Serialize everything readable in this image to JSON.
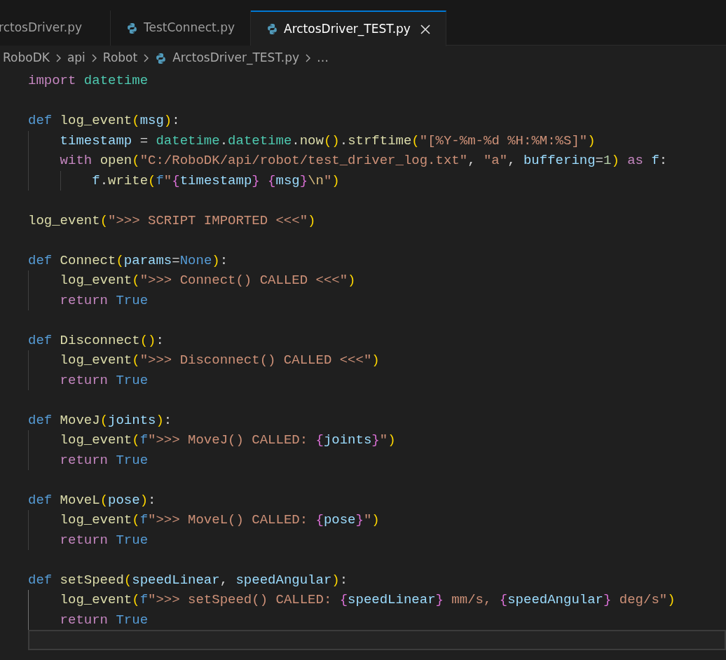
{
  "tabs": [
    {
      "label": "rctosDriver.py",
      "selected": false,
      "python": false,
      "closable": false
    },
    {
      "label": "TestConnect.py",
      "selected": false,
      "python": true,
      "closable": false
    },
    {
      "label": "ArctosDriver_TEST.py",
      "selected": true,
      "python": true,
      "closable": true
    }
  ],
  "breadcrumbs": [
    {
      "label": "RoboDK",
      "python": false
    },
    {
      "label": "api",
      "python": false
    },
    {
      "label": "Robot",
      "python": false
    },
    {
      "label": "ArctosDriver_TEST.py",
      "python": true
    },
    {
      "label": "…",
      "python": false
    }
  ],
  "lines": [
    {
      "current": false,
      "tokens": [
        {
          "kind": "ctrl",
          "text": "import "
        },
        {
          "kind": "module",
          "text": "datetime"
        }
      ]
    },
    {
      "current": false
    },
    {
      "current": false,
      "tokens": [
        {
          "kind": "kw",
          "text": "def "
        },
        {
          "kind": "fn",
          "text": "log_event"
        },
        {
          "kind": "paren",
          "text": "("
        },
        {
          "kind": "var",
          "text": "msg"
        },
        {
          "kind": "paren",
          "text": ")"
        },
        {
          "kind": "plain",
          "text": ":"
        }
      ]
    },
    {
      "current": false,
      "tokens": [
        {
          "kind": "var",
          "text": "    timestamp"
        },
        {
          "kind": "plain",
          "text": " = "
        },
        {
          "kind": "module",
          "text": "datetime"
        },
        {
          "kind": "plain",
          "text": "."
        },
        {
          "kind": "module",
          "text": "datetime"
        },
        {
          "kind": "plain",
          "text": "."
        },
        {
          "kind": "fn",
          "text": "now"
        },
        {
          "kind": "paren",
          "text": "()"
        },
        {
          "kind": "plain",
          "text": "."
        },
        {
          "kind": "fn",
          "text": "strftime"
        },
        {
          "kind": "paren",
          "text": "("
        },
        {
          "kind": "str",
          "text": "\"[%Y-%m-%d %H:%M:%S]\""
        },
        {
          "kind": "paren",
          "text": ")"
        }
      ]
    },
    {
      "current": false,
      "tokens": [
        {
          "kind": "ctrl",
          "text": "    with "
        },
        {
          "kind": "fn",
          "text": "open"
        },
        {
          "kind": "paren",
          "text": "("
        },
        {
          "kind": "str",
          "text": "\"C:/RoboDK/api/robot/test_driver_log.txt\""
        },
        {
          "kind": "plain",
          "text": ", "
        },
        {
          "kind": "str",
          "text": "\"a\""
        },
        {
          "kind": "plain",
          "text": ", "
        },
        {
          "kind": "var",
          "text": "buffering"
        },
        {
          "kind": "plain",
          "text": "="
        },
        {
          "kind": "num",
          "text": "1"
        },
        {
          "kind": "paren",
          "text": ")"
        },
        {
          "kind": "ctrl",
          "text": " as "
        },
        {
          "kind": "var",
          "text": "f"
        },
        {
          "kind": "plain",
          "text": ":"
        }
      ]
    },
    {
      "current": false,
      "tokens": [
        {
          "kind": "var",
          "text": "        f"
        },
        {
          "kind": "plain",
          "text": "."
        },
        {
          "kind": "fn",
          "text": "write"
        },
        {
          "kind": "paren",
          "text": "("
        },
        {
          "kind": "kw",
          "text": "f"
        },
        {
          "kind": "str",
          "text": "\""
        },
        {
          "kind": "brace",
          "text": "{"
        },
        {
          "kind": "var",
          "text": "timestamp"
        },
        {
          "kind": "brace",
          "text": "} {"
        },
        {
          "kind": "var",
          "text": "msg"
        },
        {
          "kind": "brace",
          "text": "}"
        },
        {
          "kind": "esc",
          "text": "\\n"
        },
        {
          "kind": "str",
          "text": "\""
        },
        {
          "kind": "paren",
          "text": ")"
        }
      ]
    },
    {
      "current": false
    },
    {
      "current": false,
      "tokens": [
        {
          "kind": "fn",
          "text": "log_event"
        },
        {
          "kind": "paren",
          "text": "("
        },
        {
          "kind": "str",
          "text": "\">>> SCRIPT IMPORTED <<<\""
        },
        {
          "kind": "paren",
          "text": ")"
        }
      ]
    },
    {
      "current": false
    },
    {
      "current": false,
      "tokens": [
        {
          "kind": "kw",
          "text": "def "
        },
        {
          "kind": "fn",
          "text": "Connect"
        },
        {
          "kind": "paren",
          "text": "("
        },
        {
          "kind": "var",
          "text": "params"
        },
        {
          "kind": "plain",
          "text": "="
        },
        {
          "kind": "kw",
          "text": "None"
        },
        {
          "kind": "paren",
          "text": ")"
        },
        {
          "kind": "plain",
          "text": ":"
        }
      ]
    },
    {
      "current": false,
      "tokens": [
        {
          "kind": "fn",
          "text": "    log_event"
        },
        {
          "kind": "paren",
          "text": "("
        },
        {
          "kind": "str",
          "text": "\">>> Connect() CALLED <<<\""
        },
        {
          "kind": "paren",
          "text": ")"
        }
      ]
    },
    {
      "current": false,
      "tokens": [
        {
          "kind": "ctrl",
          "text": "    return "
        },
        {
          "kind": "kw",
          "text": "True"
        }
      ]
    },
    {
      "current": false
    },
    {
      "current": false,
      "tokens": [
        {
          "kind": "kw",
          "text": "def "
        },
        {
          "kind": "fn",
          "text": "Disconnect"
        },
        {
          "kind": "paren",
          "text": "()"
        },
        {
          "kind": "plain",
          "text": ":"
        }
      ]
    },
    {
      "current": false,
      "tokens": [
        {
          "kind": "fn",
          "text": "    log_event"
        },
        {
          "kind": "paren",
          "text": "("
        },
        {
          "kind": "str",
          "text": "\">>> Disconnect() CALLED <<<\""
        },
        {
          "kind": "paren",
          "text": ")"
        }
      ]
    },
    {
      "current": false,
      "tokens": [
        {
          "kind": "ctrl",
          "text": "    return "
        },
        {
          "kind": "kw",
          "text": "True"
        }
      ]
    },
    {
      "current": false
    },
    {
      "current": false,
      "tokens": [
        {
          "kind": "kw",
          "text": "def "
        },
        {
          "kind": "fn",
          "text": "MoveJ"
        },
        {
          "kind": "paren",
          "text": "("
        },
        {
          "kind": "var",
          "text": "joints"
        },
        {
          "kind": "paren",
          "text": ")"
        },
        {
          "kind": "plain",
          "text": ":"
        }
      ]
    },
    {
      "current": false,
      "tokens": [
        {
          "kind": "fn",
          "text": "    log_event"
        },
        {
          "kind": "paren",
          "text": "("
        },
        {
          "kind": "kw",
          "text": "f"
        },
        {
          "kind": "str",
          "text": "\">>> MoveJ() CALLED: "
        },
        {
          "kind": "brace",
          "text": "{"
        },
        {
          "kind": "var",
          "text": "joints"
        },
        {
          "kind": "brace",
          "text": "}"
        },
        {
          "kind": "str",
          "text": "\""
        },
        {
          "kind": "paren",
          "text": ")"
        }
      ]
    },
    {
      "current": false,
      "tokens": [
        {
          "kind": "ctrl",
          "text": "    return "
        },
        {
          "kind": "kw",
          "text": "True"
        }
      ]
    },
    {
      "current": false
    },
    {
      "current": false,
      "tokens": [
        {
          "kind": "kw",
          "text": "def "
        },
        {
          "kind": "fn",
          "text": "MoveL"
        },
        {
          "kind": "paren",
          "text": "("
        },
        {
          "kind": "var",
          "text": "pose"
        },
        {
          "kind": "paren",
          "text": ")"
        },
        {
          "kind": "plain",
          "text": ":"
        }
      ]
    },
    {
      "current": false,
      "tokens": [
        {
          "kind": "fn",
          "text": "    log_event"
        },
        {
          "kind": "paren",
          "text": "("
        },
        {
          "kind": "kw",
          "text": "f"
        },
        {
          "kind": "str",
          "text": "\">>> MoveL() CALLED: "
        },
        {
          "kind": "brace",
          "text": "{"
        },
        {
          "kind": "var",
          "text": "pose"
        },
        {
          "kind": "brace",
          "text": "}"
        },
        {
          "kind": "str",
          "text": "\""
        },
        {
          "kind": "paren",
          "text": ")"
        }
      ]
    },
    {
      "current": false,
      "tokens": [
        {
          "kind": "ctrl",
          "text": "    return "
        },
        {
          "kind": "kw",
          "text": "True"
        }
      ]
    },
    {
      "current": false
    },
    {
      "current": false,
      "tokens": [
        {
          "kind": "kw",
          "text": "def "
        },
        {
          "kind": "fn",
          "text": "setSpeed"
        },
        {
          "kind": "paren",
          "text": "("
        },
        {
          "kind": "var",
          "text": "speedLinear"
        },
        {
          "kind": "plain",
          "text": ", "
        },
        {
          "kind": "var",
          "text": "speedAngular"
        },
        {
          "kind": "paren",
          "text": ")"
        },
        {
          "kind": "plain",
          "text": ":"
        }
      ]
    },
    {
      "current": false,
      "tokens": [
        {
          "kind": "fn",
          "text": "    log_event"
        },
        {
          "kind": "paren",
          "text": "("
        },
        {
          "kind": "kw",
          "text": "f"
        },
        {
          "kind": "str",
          "text": "\">>> setSpeed() CALLED: "
        },
        {
          "kind": "brace",
          "text": "{"
        },
        {
          "kind": "var",
          "text": "speedLinear"
        },
        {
          "kind": "brace",
          "text": "}"
        },
        {
          "kind": "str",
          "text": " mm/s, "
        },
        {
          "kind": "brace",
          "text": "{"
        },
        {
          "kind": "var",
          "text": "speedAngular"
        },
        {
          "kind": "brace",
          "text": "}"
        },
        {
          "kind": "str",
          "text": " deg/s\""
        },
        {
          "kind": "paren",
          "text": ")"
        }
      ]
    },
    {
      "current": false,
      "tokens": [
        {
          "kind": "ctrl",
          "text": "    return "
        },
        {
          "kind": "kw",
          "text": "True"
        }
      ]
    },
    {
      "current": true
    }
  ]
}
